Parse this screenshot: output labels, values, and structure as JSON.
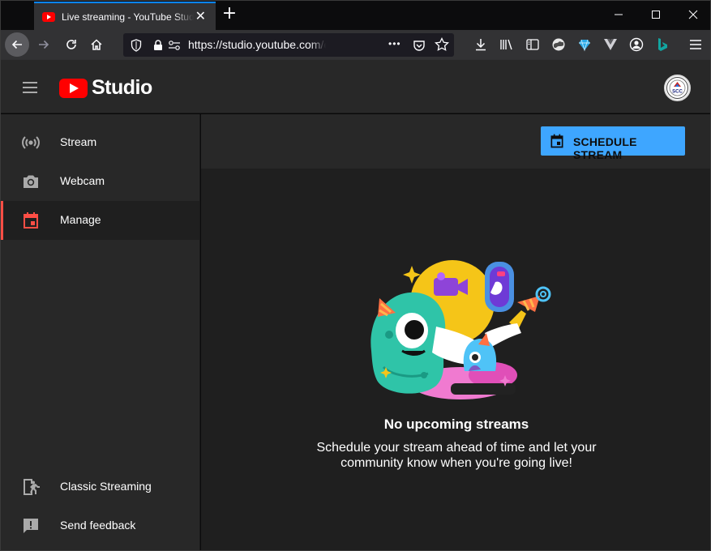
{
  "browser": {
    "tab_title": "Live streaming - YouTube Studio",
    "url": "https://studio.youtube.com/channel/UC",
    "url_more": "•••"
  },
  "studio": {
    "logo_text": "Studio",
    "avatar_text": "SCC"
  },
  "sidebar": {
    "items": [
      {
        "label": "Stream",
        "icon": "live-stream-icon"
      },
      {
        "label": "Webcam",
        "icon": "camera-icon"
      },
      {
        "label": "Manage",
        "icon": "calendar-icon",
        "active": true
      },
      {
        "label": "Classic Streaming",
        "icon": "exit-icon"
      },
      {
        "label": "Send feedback",
        "icon": "feedback-icon"
      }
    ]
  },
  "main": {
    "schedule_button": "SCHEDULE STREAM",
    "empty_title": "No upcoming streams",
    "empty_line1": "Schedule your stream ahead of time and let your",
    "empty_line2": "community know when you're going live!"
  },
  "colors": {
    "accent_blue": "#3ea6ff",
    "active_red": "#ff4e45",
    "youtube_red": "#ff0000",
    "firefox_blue": "#0a84ff"
  }
}
